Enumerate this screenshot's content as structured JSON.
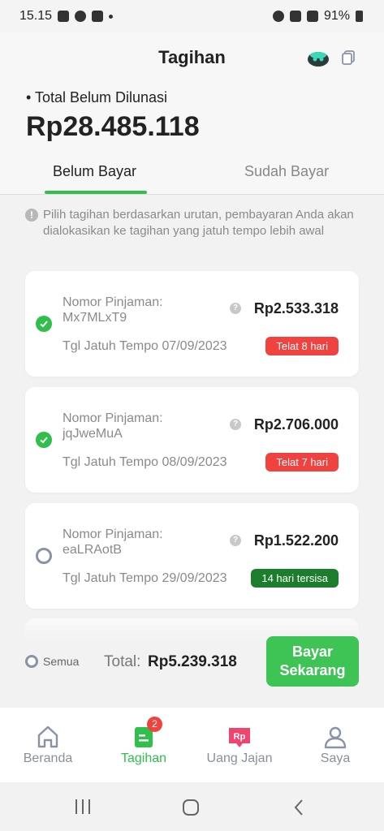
{
  "status_bar": {
    "time": "15.15",
    "battery": "91%"
  },
  "header": {
    "title": "Tagihan"
  },
  "summary": {
    "label": "• Total Belum Dilunasi",
    "amount": "Rp28.485.118"
  },
  "tabs": [
    {
      "label": "Belum Bayar",
      "active": true
    },
    {
      "label": "Sudah Bayar",
      "active": false
    }
  ],
  "info": {
    "text": "Pilih tagihan berdasarkan urutan, pembayaran Anda akan dialokasikan ke tagihan yang jatuh tempo lebih awal"
  },
  "loans": [
    {
      "label": "Nomor Pinjaman:",
      "id": "Mx7MLxT9",
      "amount": "Rp2.533.318",
      "due": "Tgl Jatuh Tempo 07/09/2023",
      "badge": "Telat 8 hari",
      "selected": true
    },
    {
      "label": "Nomor Pinjaman:",
      "id": "jqJweMuA",
      "amount": "Rp2.706.000",
      "due": "Tgl Jatuh Tempo 08/09/2023",
      "badge": "Telat 7 hari",
      "selected": true
    },
    {
      "label": "Nomor Pinjaman:",
      "id": "eaLRAotB",
      "amount": "Rp1.522.200",
      "due": "Tgl Jatuh Tempo 29/09/2023",
      "badge": "14 hari tersisa",
      "selected": false
    }
  ],
  "paybar": {
    "all_label": "Semua",
    "total_label": "Total:",
    "total_amount": "Rp5.239.318",
    "button_line1": "Bayar",
    "button_line2": "Sekarang"
  },
  "bottom_nav": [
    {
      "label": "Beranda",
      "icon": "home-icon",
      "active": false
    },
    {
      "label": "Tagihan",
      "icon": "bill-icon",
      "active": true,
      "badge": "2"
    },
    {
      "label": "Uang Jajan",
      "icon": "pocket-money-icon",
      "active": false
    },
    {
      "label": "Saya",
      "icon": "profile-icon",
      "active": false
    }
  ],
  "colors": {
    "accent": "#2fbf4a",
    "late": "#f0433f",
    "remaining": "#1c7d2c"
  }
}
